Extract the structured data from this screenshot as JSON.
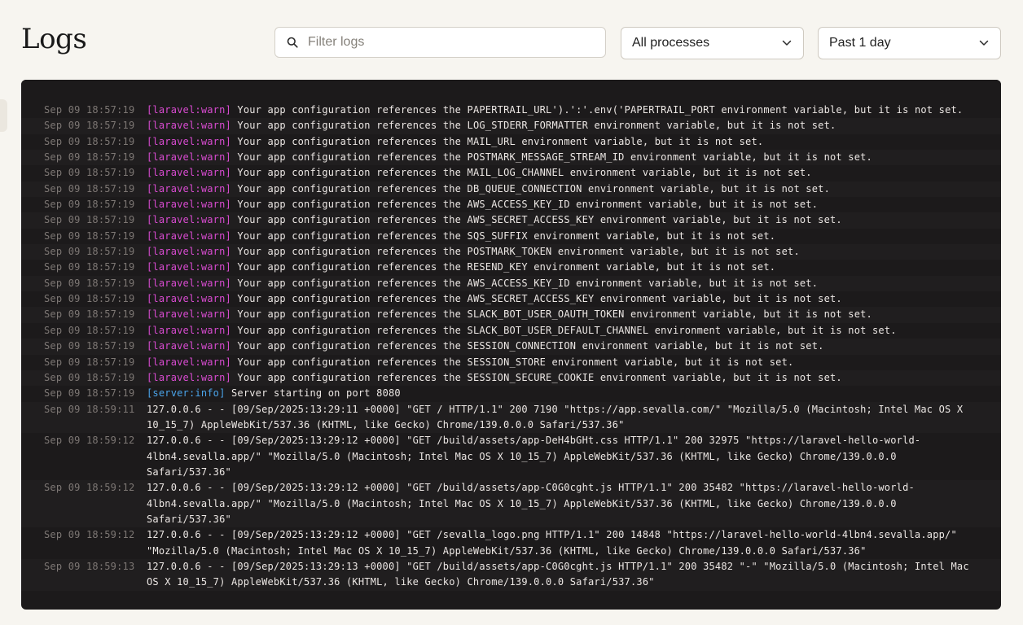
{
  "page": {
    "title": "Logs"
  },
  "filters": {
    "search_placeholder": "Filter logs",
    "process_selected": "All processes",
    "range_selected": "Past 1 day"
  },
  "colors": {
    "warn_tag": "#d84bd0",
    "info_tag": "#4aa4ea",
    "panel_bg": "#1c1a1b"
  },
  "logs": [
    {
      "ts": "Sep 09 18:57:19",
      "tag": "[laravel:warn]",
      "level": "warn",
      "msg": "Your app configuration references the PAPERTRAIL_URL').':'.env('PAPERTRAIL_PORT environment variable, but it is not set."
    },
    {
      "ts": "Sep 09 18:57:19",
      "tag": "[laravel:warn]",
      "level": "warn",
      "msg": "Your app configuration references the LOG_STDERR_FORMATTER environment variable, but it is not set."
    },
    {
      "ts": "Sep 09 18:57:19",
      "tag": "[laravel:warn]",
      "level": "warn",
      "msg": "Your app configuration references the MAIL_URL environment variable, but it is not set."
    },
    {
      "ts": "Sep 09 18:57:19",
      "tag": "[laravel:warn]",
      "level": "warn",
      "msg": "Your app configuration references the POSTMARK_MESSAGE_STREAM_ID environment variable, but it is not set."
    },
    {
      "ts": "Sep 09 18:57:19",
      "tag": "[laravel:warn]",
      "level": "warn",
      "msg": "Your app configuration references the MAIL_LOG_CHANNEL environment variable, but it is not set."
    },
    {
      "ts": "Sep 09 18:57:19",
      "tag": "[laravel:warn]",
      "level": "warn",
      "msg": "Your app configuration references the DB_QUEUE_CONNECTION environment variable, but it is not set."
    },
    {
      "ts": "Sep 09 18:57:19",
      "tag": "[laravel:warn]",
      "level": "warn",
      "msg": "Your app configuration references the AWS_ACCESS_KEY_ID environment variable, but it is not set."
    },
    {
      "ts": "Sep 09 18:57:19",
      "tag": "[laravel:warn]",
      "level": "warn",
      "msg": "Your app configuration references the AWS_SECRET_ACCESS_KEY environment variable, but it is not set."
    },
    {
      "ts": "Sep 09 18:57:19",
      "tag": "[laravel:warn]",
      "level": "warn",
      "msg": "Your app configuration references the SQS_SUFFIX environment variable, but it is not set."
    },
    {
      "ts": "Sep 09 18:57:19",
      "tag": "[laravel:warn]",
      "level": "warn",
      "msg": "Your app configuration references the POSTMARK_TOKEN environment variable, but it is not set."
    },
    {
      "ts": "Sep 09 18:57:19",
      "tag": "[laravel:warn]",
      "level": "warn",
      "msg": "Your app configuration references the RESEND_KEY environment variable, but it is not set."
    },
    {
      "ts": "Sep 09 18:57:19",
      "tag": "[laravel:warn]",
      "level": "warn",
      "msg": "Your app configuration references the AWS_ACCESS_KEY_ID environment variable, but it is not set."
    },
    {
      "ts": "Sep 09 18:57:19",
      "tag": "[laravel:warn]",
      "level": "warn",
      "msg": "Your app configuration references the AWS_SECRET_ACCESS_KEY environment variable, but it is not set."
    },
    {
      "ts": "Sep 09 18:57:19",
      "tag": "[laravel:warn]",
      "level": "warn",
      "msg": "Your app configuration references the SLACK_BOT_USER_OAUTH_TOKEN environment variable, but it is not set."
    },
    {
      "ts": "Sep 09 18:57:19",
      "tag": "[laravel:warn]",
      "level": "warn",
      "msg": "Your app configuration references the SLACK_BOT_USER_DEFAULT_CHANNEL environment variable, but it is not set."
    },
    {
      "ts": "Sep 09 18:57:19",
      "tag": "[laravel:warn]",
      "level": "warn",
      "msg": "Your app configuration references the SESSION_CONNECTION environment variable, but it is not set."
    },
    {
      "ts": "Sep 09 18:57:19",
      "tag": "[laravel:warn]",
      "level": "warn",
      "msg": "Your app configuration references the SESSION_STORE environment variable, but it is not set."
    },
    {
      "ts": "Sep 09 18:57:19",
      "tag": "[laravel:warn]",
      "level": "warn",
      "msg": "Your app configuration references the SESSION_SECURE_COOKIE environment variable, but it is not set."
    },
    {
      "ts": "Sep 09 18:57:19",
      "tag": "[server:info]",
      "level": "info",
      "msg": "Server starting on port 8080"
    },
    {
      "ts": "Sep 09 18:59:11",
      "tag": "",
      "level": "plain",
      "msg": "127.0.0.6 - - [09/Sep/2025:13:29:11 +0000] \"GET / HTTP/1.1\" 200 7190 \"https://app.sevalla.com/\" \"Mozilla/5.0 (Macintosh; Intel Mac OS X 10_15_7) AppleWebKit/537.36 (KHTML, like Gecko) Chrome/139.0.0.0 Safari/537.36\""
    },
    {
      "ts": "Sep 09 18:59:12",
      "tag": "",
      "level": "plain",
      "msg": "127.0.0.6 - - [09/Sep/2025:13:29:12 +0000] \"GET /build/assets/app-DeH4bGHt.css HTTP/1.1\" 200 32975 \"https://laravel-hello-world-4lbn4.sevalla.app/\" \"Mozilla/5.0 (Macintosh; Intel Mac OS X 10_15_7) AppleWebKit/537.36 (KHTML, like Gecko) Chrome/139.0.0.0 Safari/537.36\""
    },
    {
      "ts": "Sep 09 18:59:12",
      "tag": "",
      "level": "plain",
      "msg": "127.0.0.6 - - [09/Sep/2025:13:29:12 +0000] \"GET /build/assets/app-C0G0cght.js HTTP/1.1\" 200 35482 \"https://laravel-hello-world-4lbn4.sevalla.app/\" \"Mozilla/5.0 (Macintosh; Intel Mac OS X 10_15_7) AppleWebKit/537.36 (KHTML, like Gecko) Chrome/139.0.0.0 Safari/537.36\""
    },
    {
      "ts": "Sep 09 18:59:12",
      "tag": "",
      "level": "plain",
      "msg": "127.0.0.6 - - [09/Sep/2025:13:29:12 +0000] \"GET /sevalla_logo.png HTTP/1.1\" 200 14848 \"https://laravel-hello-world-4lbn4.sevalla.app/\" \"Mozilla/5.0 (Macintosh; Intel Mac OS X 10_15_7) AppleWebKit/537.36 (KHTML, like Gecko) Chrome/139.0.0.0 Safari/537.36\""
    },
    {
      "ts": "Sep 09 18:59:13",
      "tag": "",
      "level": "plain",
      "msg": "127.0.0.6 - - [09/Sep/2025:13:29:13 +0000] \"GET /build/assets/app-C0G0cght.js HTTP/1.1\" 200 35482 \"-\" \"Mozilla/5.0 (Macintosh; Intel Mac OS X 10_15_7) AppleWebKit/537.36 (KHTML, like Gecko) Chrome/139.0.0.0 Safari/537.36\""
    }
  ]
}
